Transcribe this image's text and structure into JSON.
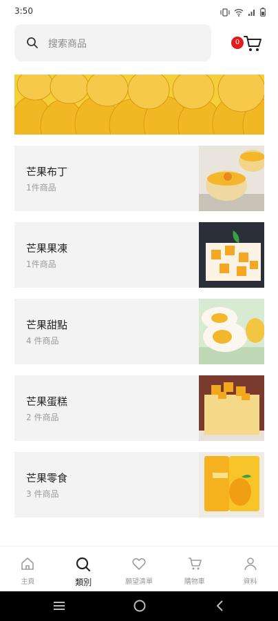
{
  "status_bar": {
    "time": "3:50"
  },
  "search": {
    "placeholder": "搜索商品"
  },
  "cart": {
    "badge_count": "0"
  },
  "categories": [
    {
      "name": "芒果布丁",
      "count": "1件商品"
    },
    {
      "name": "芒果果凍",
      "count": "1件商品"
    },
    {
      "name": "芒果甜點",
      "count": "4 件商品"
    },
    {
      "name": "芒果蛋糕",
      "count": "2 件商品"
    },
    {
      "name": "芒果零食",
      "count": "3 件商品"
    }
  ],
  "nav": [
    {
      "label": "主頁"
    },
    {
      "label": "類別"
    },
    {
      "label": "願望清單"
    },
    {
      "label": "購物車"
    },
    {
      "label": "資料"
    }
  ],
  "colors": {
    "badge": "#e21b1b",
    "mango": "#f2b824",
    "card_bg": "#f3f3f3"
  }
}
